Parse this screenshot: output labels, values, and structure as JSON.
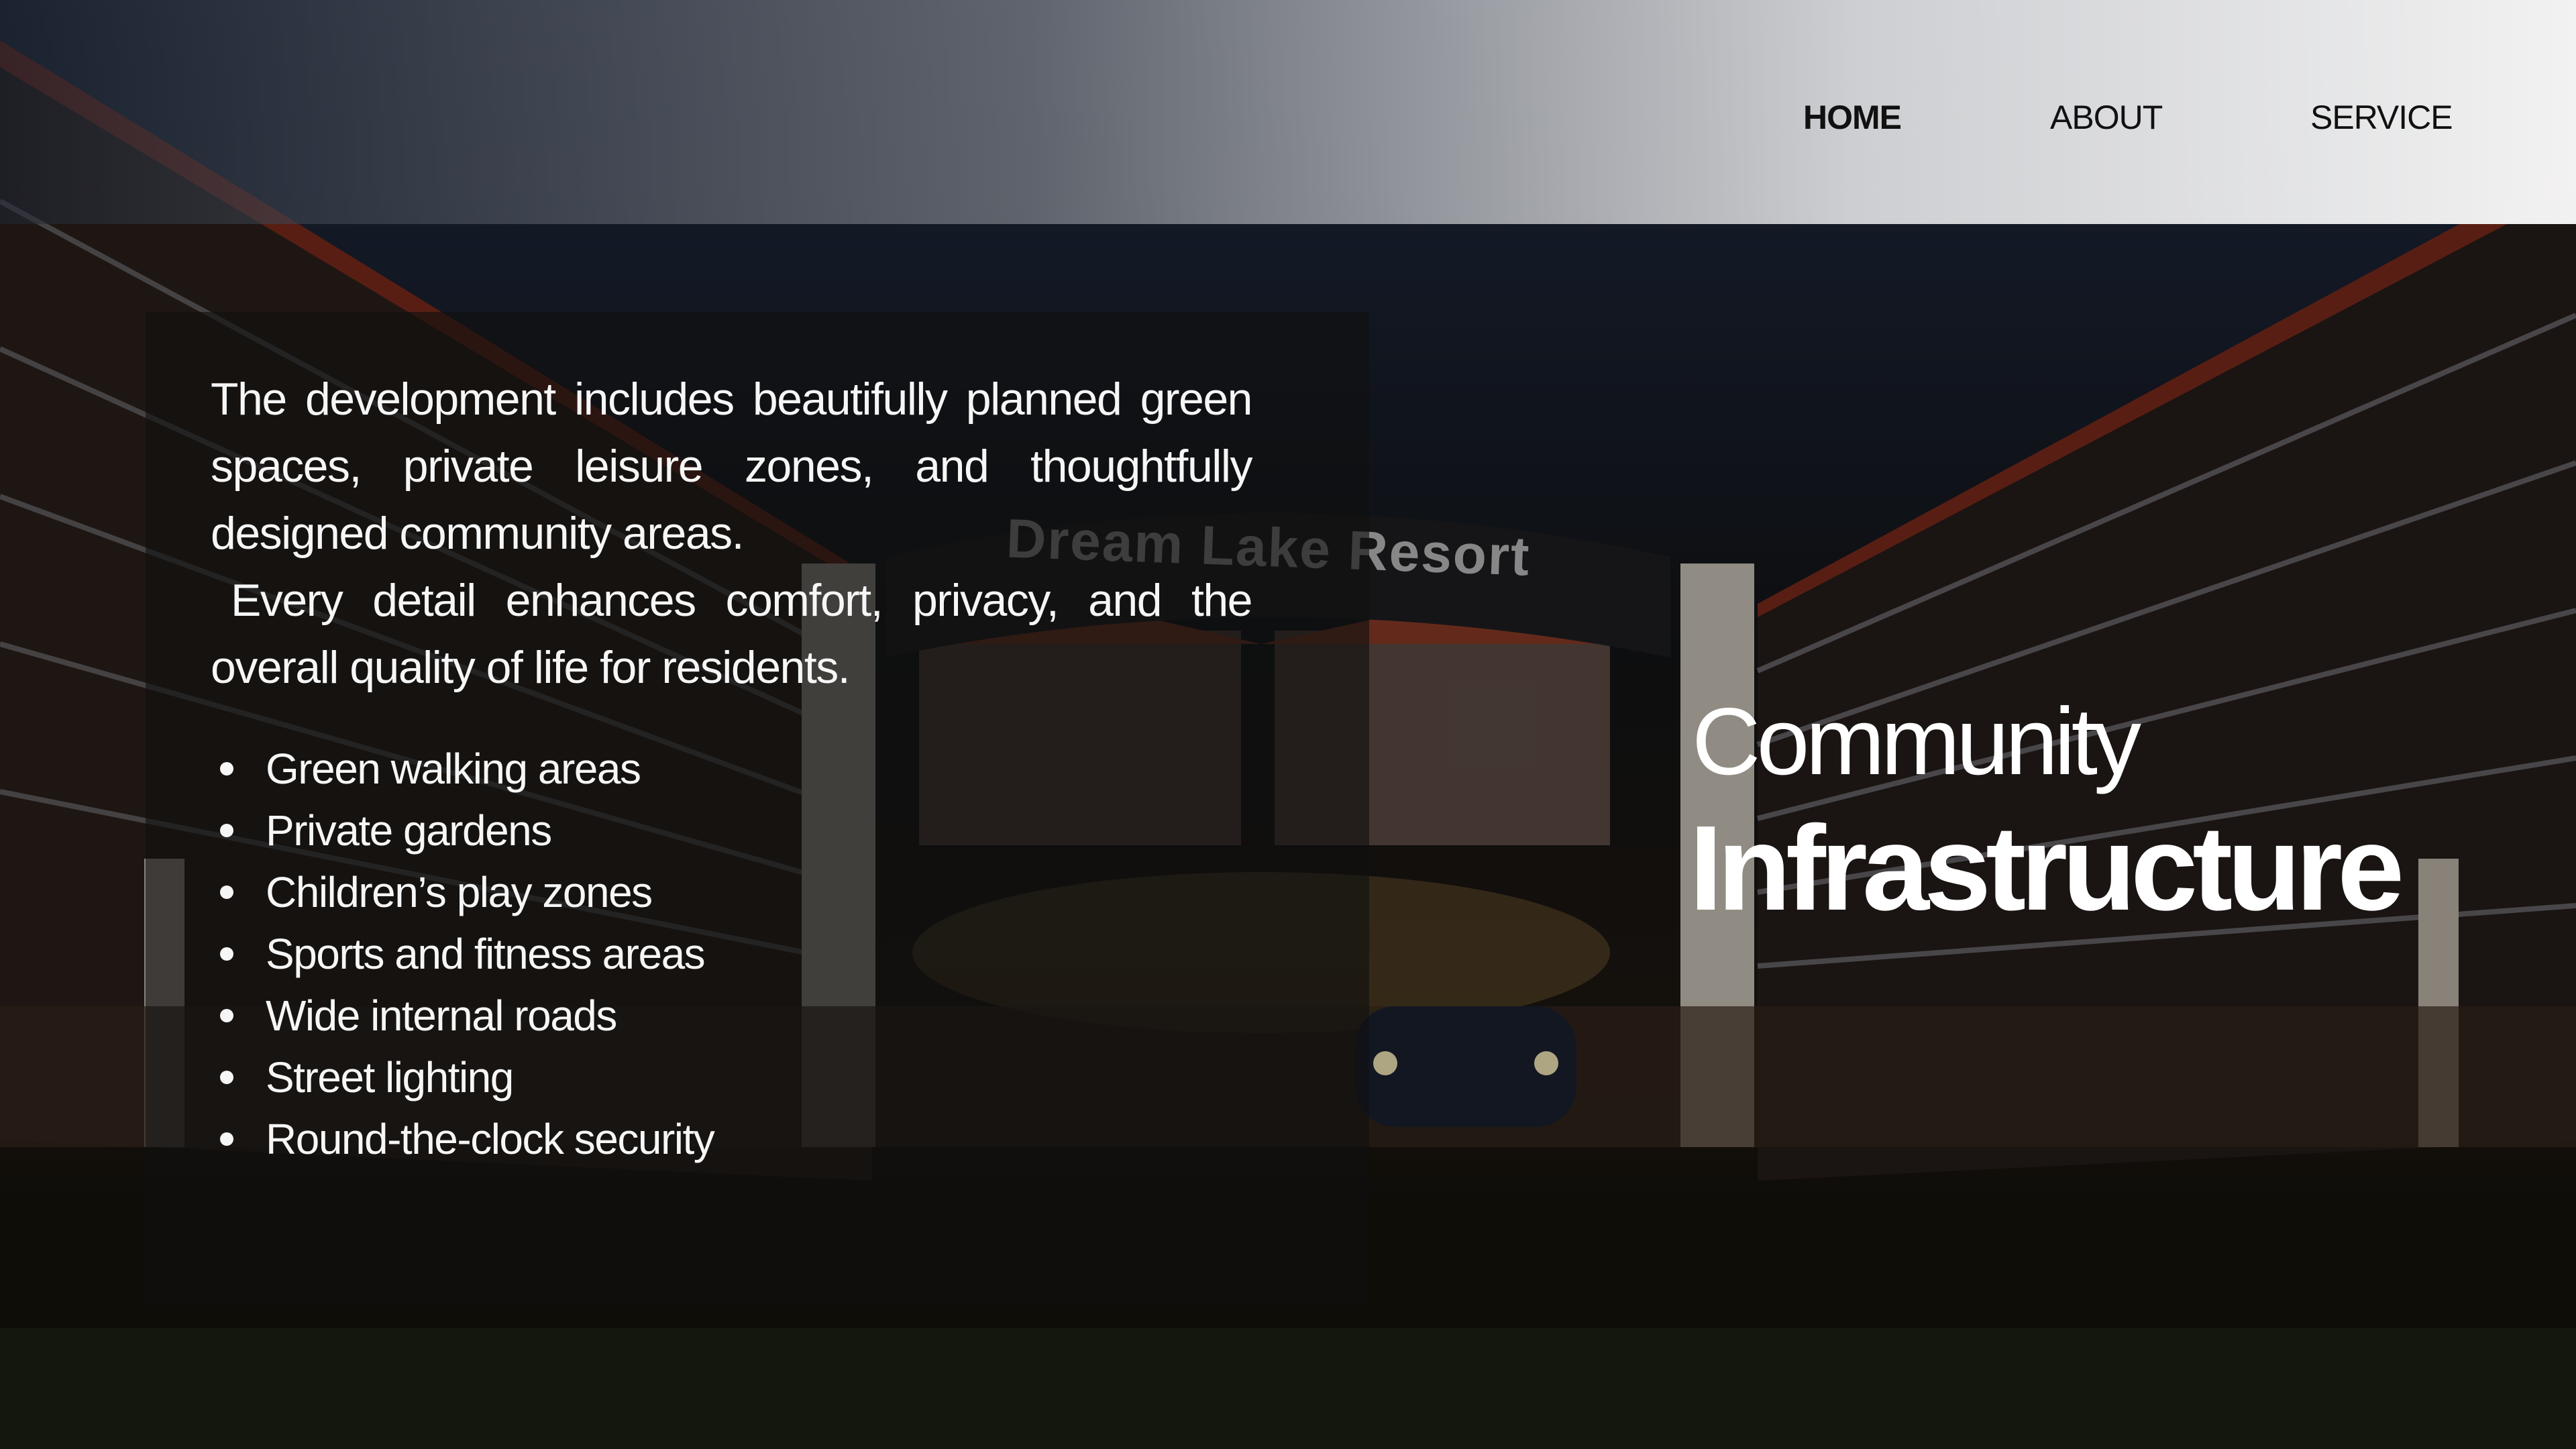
{
  "nav": {
    "items": [
      {
        "label": "HOME",
        "active": true
      },
      {
        "label": "ABOUT",
        "active": false
      },
      {
        "label": "SERVICE",
        "active": false
      }
    ]
  },
  "background": {
    "sign_text": "Dream Lake Resort"
  },
  "panel": {
    "paragraph_1": "The development includes beautifully planned green spaces, private leisure zones, and thoughtfully designed community areas.",
    "paragraph_2": "Every detail enhances comfort, privacy, and the overall quality of life for residents.",
    "features": [
      "Green walking areas",
      "Private gardens",
      "Children’s play zones",
      "Sports and fitness areas",
      "Wide internal roads",
      "Street lighting",
      "Round-the-clock security"
    ]
  },
  "heading": {
    "line_1": "Community",
    "line_2": "Infrastructure"
  },
  "colors": {
    "text_light": "#f6f6f6",
    "nav_text": "#111111",
    "panel_bg": "#101010"
  }
}
